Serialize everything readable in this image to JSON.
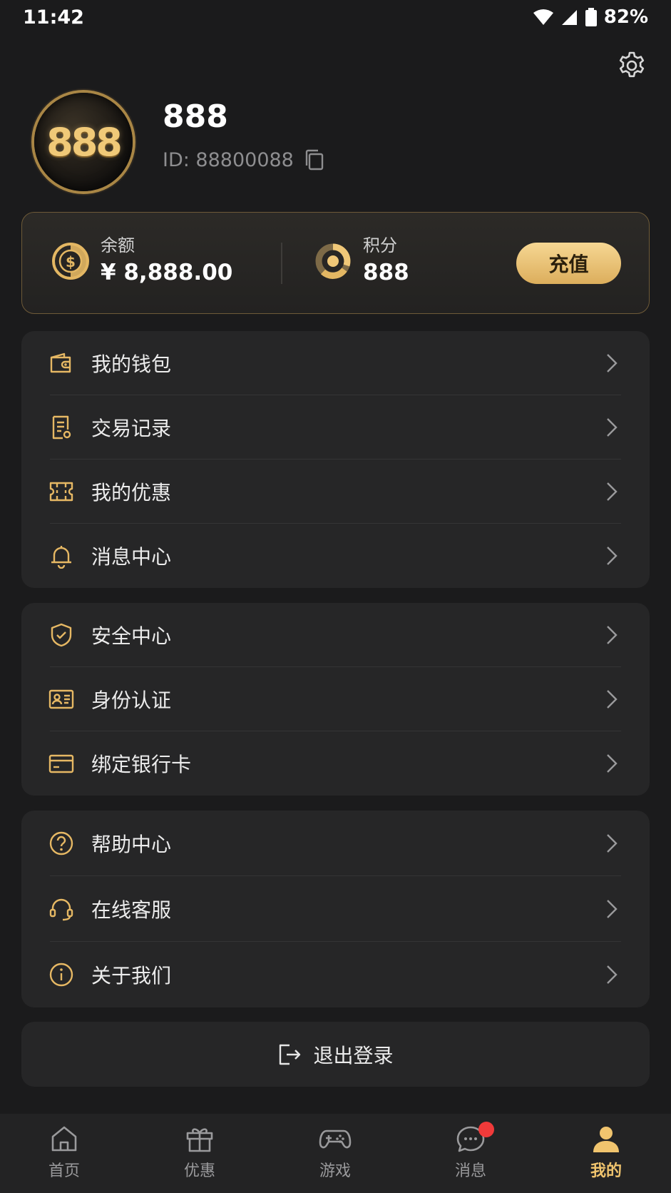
{
  "status_bar": {
    "time": "11:42",
    "battery": "82%"
  },
  "profile": {
    "avatar_text": "888",
    "username": "888",
    "user_id": "ID: 88800088"
  },
  "balance_card": {
    "balance_label": "余额",
    "balance_value": "¥ 8,888.00",
    "points_label": "积分",
    "points_value": "888",
    "recharge_label": "充值"
  },
  "menu_groups": [
    {
      "items": [
        {
          "icon": "wallet-icon",
          "label": "我的钱包"
        },
        {
          "icon": "receipt-icon",
          "label": "交易记录"
        },
        {
          "icon": "ticket-icon",
          "label": "我的优惠"
        },
        {
          "icon": "bell-icon",
          "label": "消息中心"
        }
      ]
    },
    {
      "items": [
        {
          "icon": "shield-check-icon",
          "label": "安全中心"
        },
        {
          "icon": "id-card-icon",
          "label": "身份认证"
        },
        {
          "icon": "bank-card-icon",
          "label": "绑定银行卡"
        }
      ]
    },
    {
      "items": [
        {
          "icon": "help-icon",
          "label": "帮助中心"
        },
        {
          "icon": "headset-icon",
          "label": "在线客服"
        },
        {
          "icon": "info-icon",
          "label": "关于我们"
        }
      ]
    }
  ],
  "logout": {
    "label": "退出登录"
  },
  "bottom_nav": [
    {
      "icon": "home-icon",
      "label": "首页"
    },
    {
      "icon": "gift-icon",
      "label": "优惠"
    },
    {
      "icon": "gamepad-icon",
      "label": "游戏"
    },
    {
      "icon": "chat-icon",
      "label": "消息"
    },
    {
      "icon": "user-icon",
      "label": "我的"
    }
  ],
  "colors": {
    "accent_gold": "#f0c46e",
    "badge_red": "#f03a3a",
    "background": "#1b1b1c",
    "card": "#262627"
  }
}
